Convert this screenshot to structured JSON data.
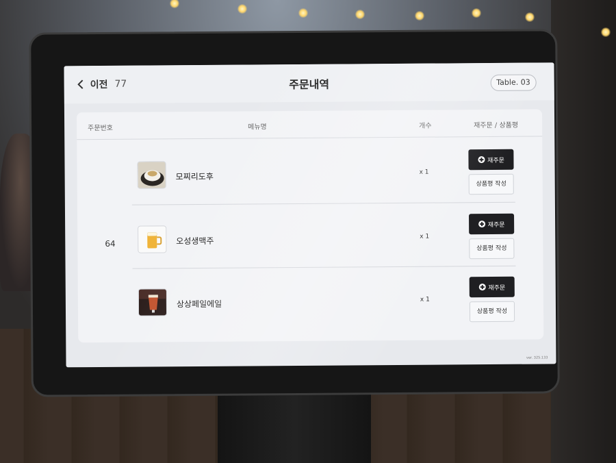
{
  "header": {
    "back_label": "이전",
    "back_count": "77",
    "title": "주문내역",
    "table_label": "Table. 03"
  },
  "columns": {
    "order_no": "주문번호",
    "menu": "메뉴명",
    "qty": "개수",
    "action": "재주문 / 상품평"
  },
  "order": {
    "number": "64",
    "items": [
      {
        "name": "모찌리도후",
        "qty": "x 1",
        "thumb": "mochi-dish-thumbnail"
      },
      {
        "name": "오성생맥주",
        "qty": "x 1",
        "thumb": "beer-mug-thumbnail"
      },
      {
        "name": "상상페일에일",
        "qty": "x 1",
        "thumb": "pale-ale-glass-thumbnail"
      }
    ]
  },
  "buttons": {
    "reorder": "재주문",
    "review": "상품평 작성"
  },
  "version": "ver. 325.133",
  "colors": {
    "screen_bg": "#e7e9ed",
    "panel_bg": "#f2f3f6",
    "reorder_btn": "#1f1f22",
    "bezel": "#161616"
  }
}
